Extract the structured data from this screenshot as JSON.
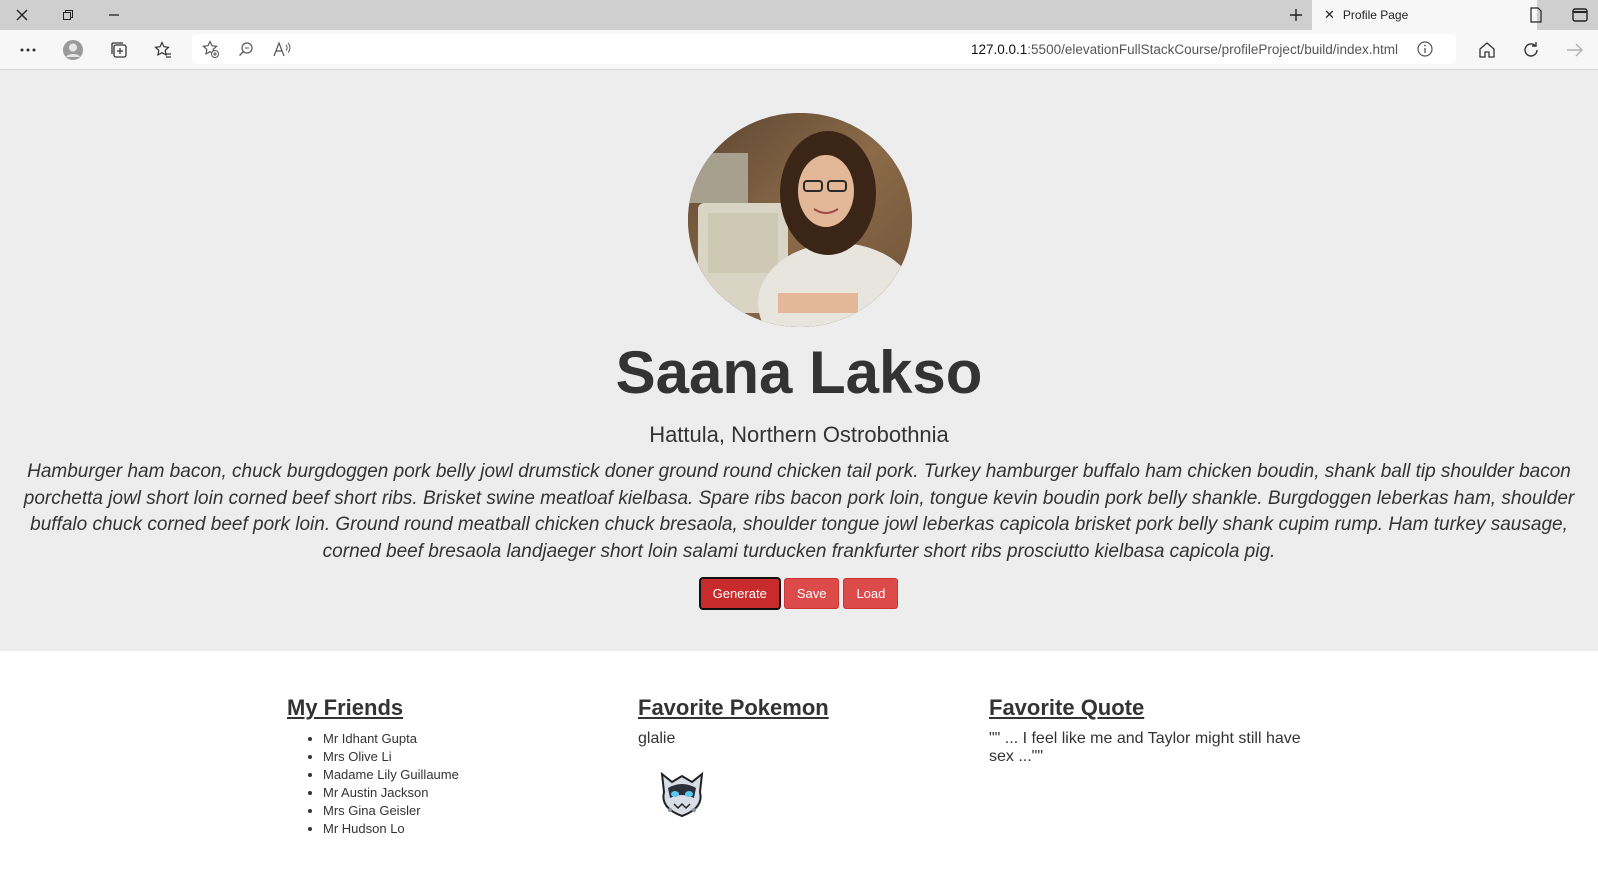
{
  "browser": {
    "tab_title": "Profile Page",
    "url_host": "127.0.0.1",
    "url_rest": ":5500/elevationFullStackCourse/profileProject/build/index.html",
    "icons": [
      "close-icon",
      "restore-icon",
      "minimize-icon",
      "new-tab-icon",
      "tab-close-icon",
      "page-icon",
      "sidebar-icon",
      "more-icon",
      "profile-icon",
      "collections-icon",
      "favorites-icon",
      "add-favorite-icon",
      "zoom-icon",
      "read-aloud-icon",
      "info-icon",
      "home-icon",
      "refresh-icon",
      "forward-icon"
    ]
  },
  "profile": {
    "name": "Saana Lakso",
    "location": "Hattula, Northern Ostrobothnia",
    "bio": "Hamburger ham bacon, chuck burgdoggen pork belly jowl drumstick doner ground round chicken tail pork. Turkey hamburger buffalo ham chicken boudin, shank ball tip shoulder bacon porchetta jowl short loin corned beef short ribs. Brisket swine meatloaf kielbasa. Spare ribs bacon pork loin, tongue kevin boudin pork belly shankle. Burgdoggen leberkas ham, shoulder buffalo chuck corned beef pork loin. Ground round meatball chicken chuck bresaola, shoulder tongue jowl leberkas capicola brisket pork belly shank cupim rump. Ham turkey sausage, corned beef bresaola landjaeger short loin salami turducken frankfurter short ribs prosciutto kielbasa capicola pig."
  },
  "actions": {
    "generate": "Generate",
    "save": "Save",
    "load": "Load"
  },
  "friends": {
    "heading": "My Friends",
    "items": [
      "Mr Idhant Gupta",
      "Mrs Olive Li",
      "Madame Lily Guillaume",
      "Mr Austin Jackson",
      "Mrs Gina Geisler",
      "Mr Hudson Lo"
    ]
  },
  "pokemon": {
    "heading": "Favorite Pokemon",
    "name": "glalie"
  },
  "quote": {
    "heading": "Favorite Quote",
    "text": "\"\" ... I feel like me and Taylor might still have sex ...\"\""
  },
  "colors": {
    "hero_bg": "#ededed",
    "button": "#dc4a4a",
    "button_active": "#c82b2b",
    "text": "#333333"
  }
}
